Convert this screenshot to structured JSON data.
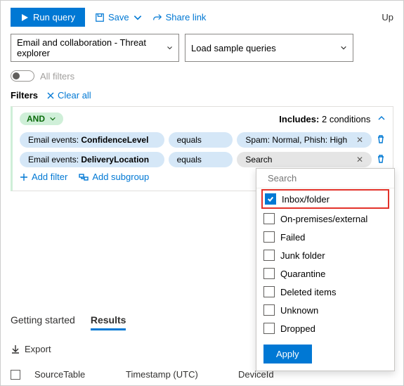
{
  "toolbar": {
    "run_label": "Run query",
    "save_label": "Save",
    "share_label": "Share link",
    "up_label": "Up"
  },
  "selectors": {
    "source": "Email and collaboration - Threat explorer",
    "sample": "Load sample queries"
  },
  "all_filters_label": "All filters",
  "filters_header": "Filters",
  "clear_all_label": "Clear all",
  "group": {
    "operator": "AND",
    "includes_label": "Includes:",
    "includes_count": "2 conditions"
  },
  "conditions": [
    {
      "field_prefix": "Email events: ",
      "field_name": "ConfidenceLevel",
      "op": "equals",
      "value": "Spam: Normal, Phish: High"
    },
    {
      "field_prefix": "Email events: ",
      "field_name": "DeliveryLocation",
      "op": "equals",
      "value": "Search"
    }
  ],
  "add_filter_label": "Add filter",
  "add_subgroup_label": "Add subgroup",
  "tabs": {
    "getting_started": "Getting started",
    "results": "Results"
  },
  "export_label": "Export",
  "columns": {
    "c0": "SourceTable",
    "c1": "Timestamp (UTC)",
    "c2": "DeviceId"
  },
  "dropdown": {
    "search_placeholder": "Search",
    "options": [
      {
        "label": "Inbox/folder",
        "checked": true,
        "highlight": true
      },
      {
        "label": "On-premises/external",
        "checked": false
      },
      {
        "label": "Failed",
        "checked": false
      },
      {
        "label": "Junk folder",
        "checked": false
      },
      {
        "label": "Quarantine",
        "checked": false
      },
      {
        "label": "Deleted items",
        "checked": false
      },
      {
        "label": "Unknown",
        "checked": false
      },
      {
        "label": "Dropped",
        "checked": false
      }
    ],
    "apply_label": "Apply"
  }
}
